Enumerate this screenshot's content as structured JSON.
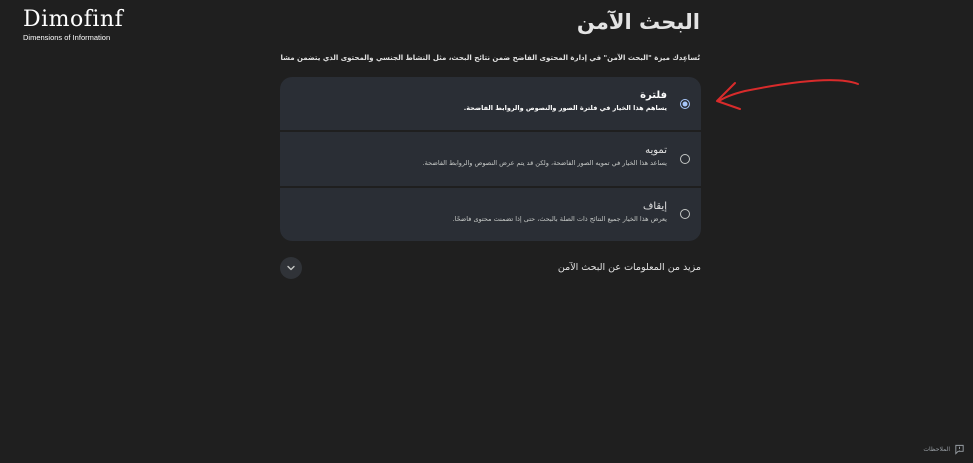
{
  "logo": {
    "wordmark": "Dimofinf",
    "tagline": "Dimensions of Information"
  },
  "page": {
    "title": "البحث الآمن",
    "description": "تُساعِدك ميزة \"البحث الآمن\" في إدارة المحتوى الفاضح ضمن نتائج البحث، مثل النشاط الجنسي والمحتوى الذي يتضمن مشاهد عنف قاسي."
  },
  "options": [
    {
      "label": "فلترة",
      "description": "يساهم هذا الخيار في فلترة الصور والنصوص والروابط الفاضحة.",
      "selected": true
    },
    {
      "label": "تمويه",
      "description": "يساعد هذا الخيار في تمويه الصور الفاضحة، ولكن قد يتم عرض النصوص والروابط الفاضحة.",
      "selected": false
    },
    {
      "label": "إيقاف",
      "description": "يعرض هذا الخيار جميع النتائج ذات الصلة بالبحث، حتى إذا تضمنت محتوى فاضحًا.",
      "selected": false
    }
  ],
  "more_info": {
    "label": "مزيد من المعلومات عن البحث الآمن",
    "toggle_icon": "chevron-down-icon"
  },
  "annotation": {
    "color": "#d92b2b"
  },
  "feedback": {
    "label": "الملاحظات",
    "icon": "feedback-icon"
  },
  "colors": {
    "background": "#1f1f1f",
    "card": "#2a2e35",
    "accent": "#a8c7fa"
  }
}
